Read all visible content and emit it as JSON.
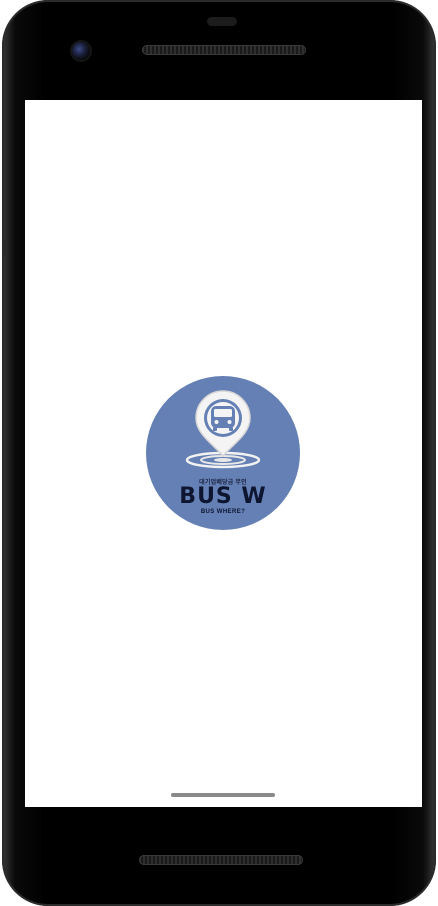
{
  "app": {
    "tagline": "대기업배당금 무인",
    "name": "BUS W",
    "subtitle": "BUS WHERE?"
  },
  "icons": {
    "logo": "bus-location-pin-icon",
    "camera": "front-camera-icon"
  },
  "colors": {
    "logo_background": "#6580b4",
    "logo_text": "#0d1530",
    "screen_background": "#ffffff",
    "device_frame": "#000000"
  }
}
